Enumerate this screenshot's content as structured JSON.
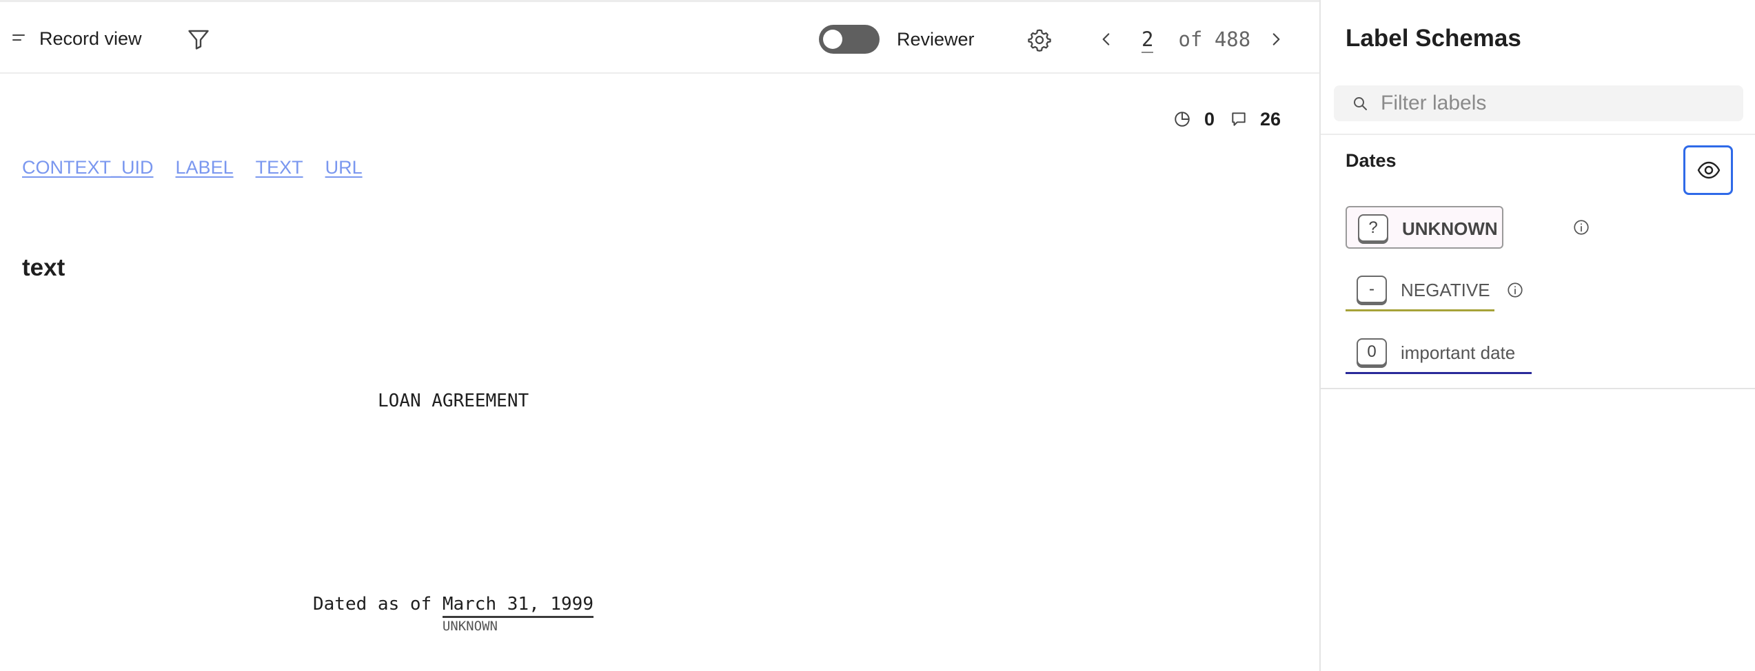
{
  "topbar": {
    "view_title": "Record view",
    "reviewer_label": "Reviewer",
    "reviewer_enabled": false,
    "pager": {
      "current": "2",
      "total_text": " of 488"
    }
  },
  "stats": {
    "clock_count": "0",
    "comment_count": "26"
  },
  "columns": [
    "CONTEXT_UID",
    "LABEL",
    "TEXT",
    "URL"
  ],
  "section_title": "text",
  "document": {
    "heading": "LOAN AGREEMENT",
    "line_prefix": "Dated as of ",
    "span_text": "March 31, 1999",
    "span_label": "UNKNOWN"
  },
  "side": {
    "title": "Label Schemas",
    "filter_placeholder": "Filter labels",
    "group_title": "Dates",
    "labels": [
      {
        "key": "?",
        "name": "UNKNOWN",
        "color": "#9a9a9a"
      },
      {
        "key": "-",
        "name": "NEGATIVE",
        "color": "#a6a238"
      },
      {
        "key": "0",
        "name": "important date",
        "color": "#2a2a9a"
      }
    ]
  },
  "colors": {
    "link": "#7a97ef",
    "focus": "#2f6ae8",
    "toggle_off": "#5f5f5f"
  },
  "icons": [
    "menu-icon",
    "filter-icon",
    "settings-icon",
    "chevron-left-icon",
    "chevron-right-icon",
    "clock-icon",
    "comment-icon",
    "search-icon",
    "eye-icon",
    "info-icon"
  ]
}
